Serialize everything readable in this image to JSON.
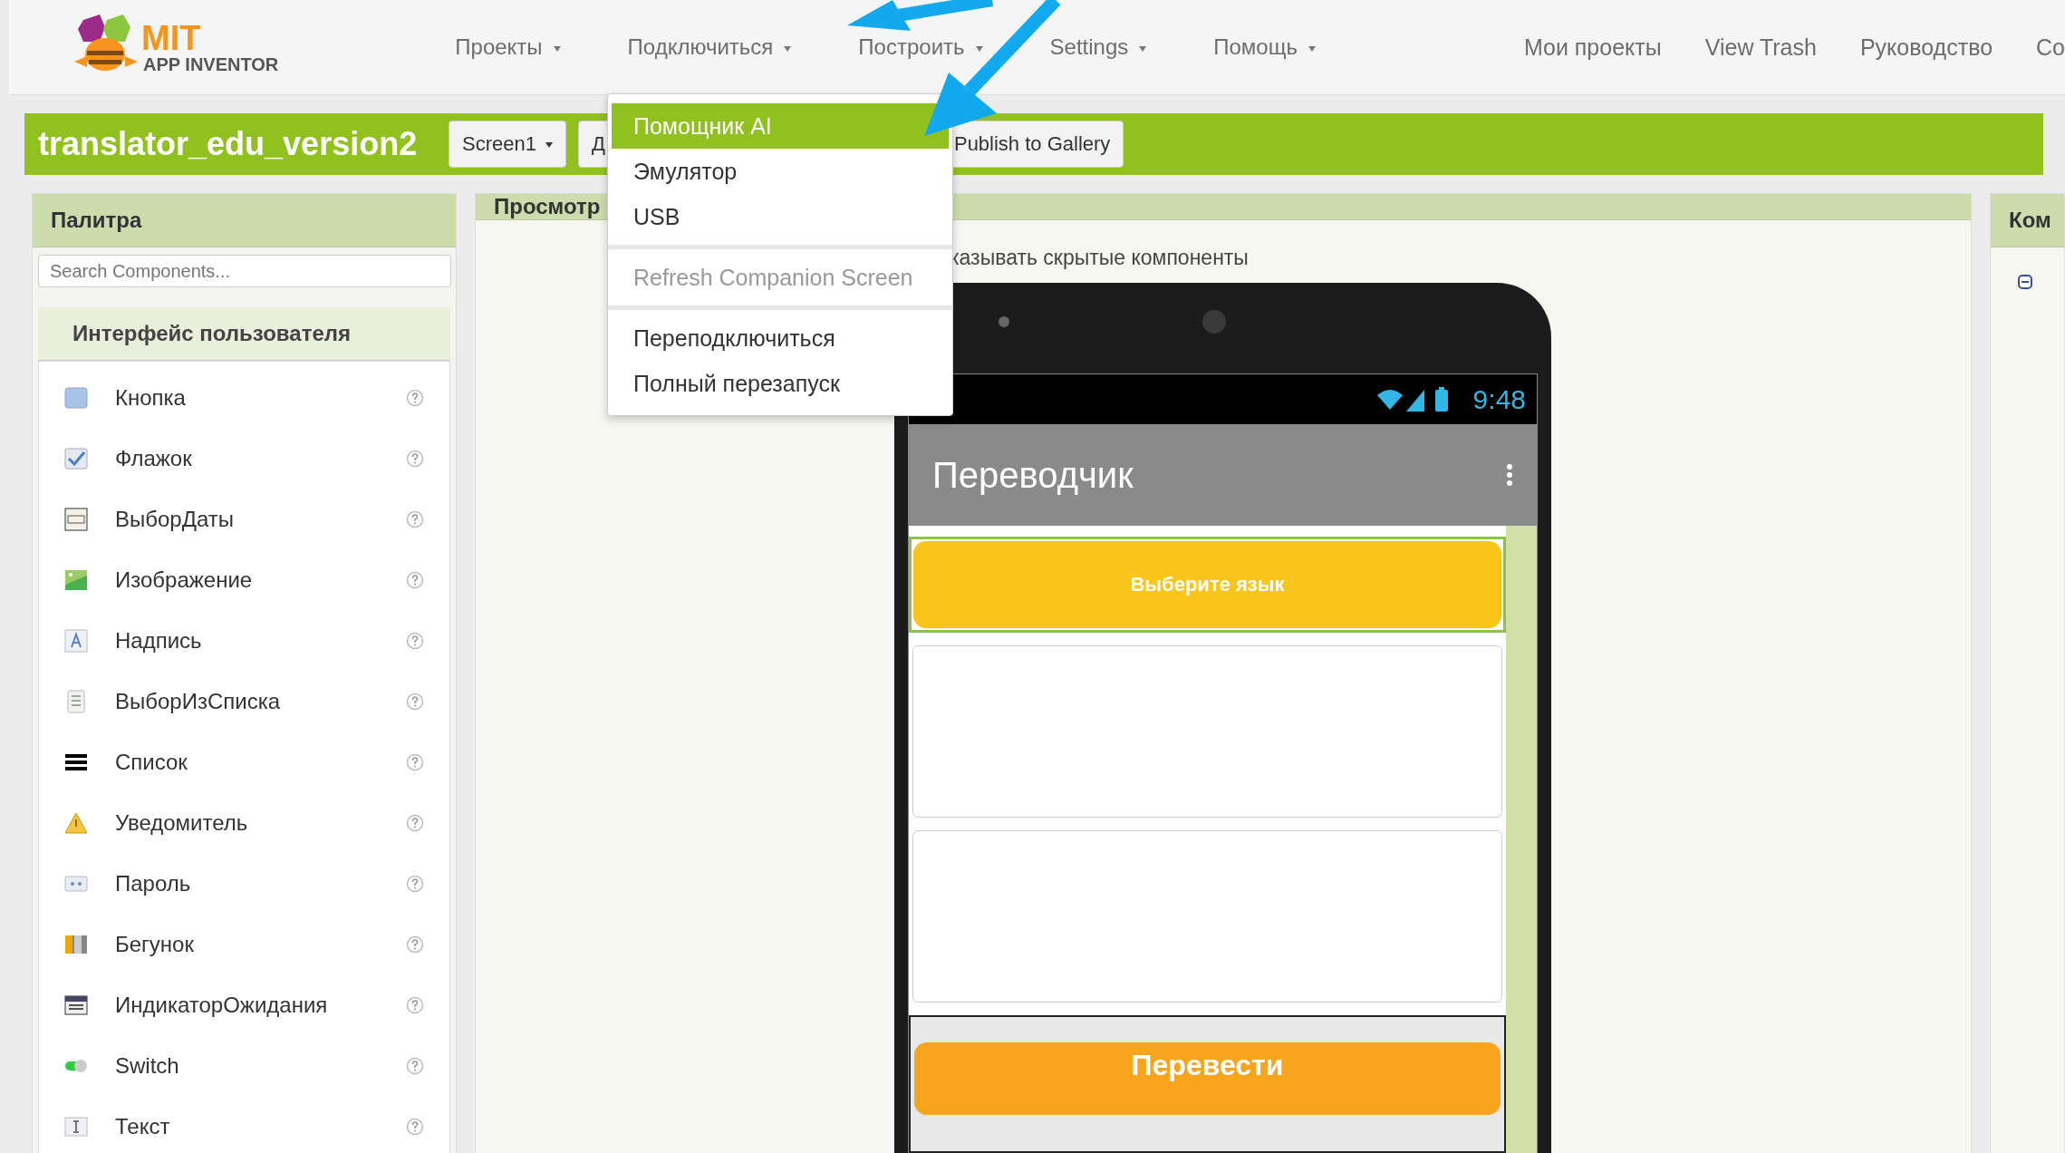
{
  "header": {
    "logo": {
      "title": "MIT",
      "subtitle": "APP INVENTOR"
    },
    "menus": [
      {
        "label": "Проекты",
        "dropdown": true
      },
      {
        "label": "Подключиться",
        "dropdown": true
      },
      {
        "label": "Построить",
        "dropdown": true
      },
      {
        "label": "Settings",
        "dropdown": true
      },
      {
        "label": "Помощь",
        "dropdown": true
      }
    ],
    "links": [
      "Мои проекты",
      "View Trash",
      "Руководство",
      "Со"
    ]
  },
  "project_bar": {
    "title": "translator_edu_version2",
    "screen_button": "Screen1",
    "partial_button": "Д",
    "publish_button": "Publish to Gallery"
  },
  "connect_menu": {
    "groups": [
      [
        {
          "label": "Помощник AI",
          "selected": true,
          "disabled": false
        },
        {
          "label": "Эмулятор",
          "selected": false,
          "disabled": false
        },
        {
          "label": "USB",
          "selected": false,
          "disabled": false
        }
      ],
      [
        {
          "label": "Refresh Companion Screen",
          "selected": false,
          "disabled": true
        }
      ],
      [
        {
          "label": "Переподключиться",
          "selected": false,
          "disabled": false
        },
        {
          "label": "Полный перезапуск",
          "selected": false,
          "disabled": false
        }
      ]
    ]
  },
  "palette": {
    "title": "Палитра",
    "search": {
      "placeholder": "Search Components..."
    },
    "section": "Интерфейс пользователя",
    "items": [
      {
        "label": "Кнопка",
        "kind": "button"
      },
      {
        "label": "Флажок",
        "kind": "checkbox"
      },
      {
        "label": "ВыборДаты",
        "kind": "datepicker"
      },
      {
        "label": "Изображение",
        "kind": "image"
      },
      {
        "label": "Надпись",
        "kind": "label"
      },
      {
        "label": "ВыборИзСписка",
        "kind": "listpicker"
      },
      {
        "label": "Список",
        "kind": "listview"
      },
      {
        "label": "Уведомитель",
        "kind": "notifier"
      },
      {
        "label": "Пароль",
        "kind": "password"
      },
      {
        "label": "Бегунок",
        "kind": "slider"
      },
      {
        "label": "ИндикаторОжидания",
        "kind": "spinner"
      },
      {
        "label": "Switch",
        "kind": "switch"
      },
      {
        "label": "Текст",
        "kind": "textbox"
      }
    ]
  },
  "viewer": {
    "title": "Просмотр",
    "hidden_components_text": "казывать скрытые компоненты",
    "phone": {
      "time": "9:48",
      "app_title": "Переводчик",
      "language_button": "Выберите язык",
      "translate_button": "Перевести"
    }
  },
  "components_panel": {
    "title": "Ком"
  }
}
